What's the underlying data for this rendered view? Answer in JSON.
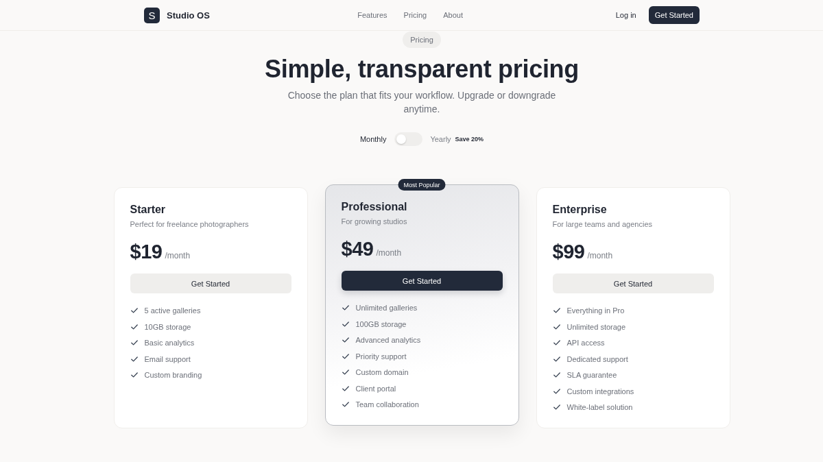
{
  "header": {
    "logo_letter": "S",
    "brand": "Studio OS",
    "nav": [
      "Features",
      "Pricing",
      "About"
    ],
    "login": "Log in",
    "cta": "Get Started"
  },
  "hero": {
    "tag": "Pricing",
    "title": "Simple, transparent pricing",
    "subtitle": "Choose the plan that fits your workflow. Upgrade or downgrade anytime."
  },
  "billing": {
    "monthly_label": "Monthly",
    "yearly_label": "Yearly",
    "yearly": false,
    "discount": "Save 20%"
  },
  "plans": [
    {
      "name": "Starter",
      "description": "Perfect for freelance photographers",
      "price": "$19",
      "period": "/month",
      "button": "Get Started",
      "featured": false,
      "features": [
        "5 active galleries",
        "10GB storage",
        "Basic analytics",
        "Email support",
        "Custom branding"
      ]
    },
    {
      "name": "Professional",
      "description": "For growing studios",
      "price": "$49",
      "period": "/month",
      "button": "Get Started",
      "featured": true,
      "badge": "Most Popular",
      "features": [
        "Unlimited galleries",
        "100GB storage",
        "Advanced analytics",
        "Priority support",
        "Custom domain",
        "Client portal",
        "Team collaboration"
      ]
    },
    {
      "name": "Enterprise",
      "description": "For large teams and agencies",
      "price": "$99",
      "period": "/month",
      "button": "Get Started",
      "featured": false,
      "features": [
        "Everything in Pro",
        "Unlimited storage",
        "API access",
        "Dedicated support",
        "SLA guarantee",
        "Custom integrations",
        "White-label solution"
      ]
    }
  ]
}
